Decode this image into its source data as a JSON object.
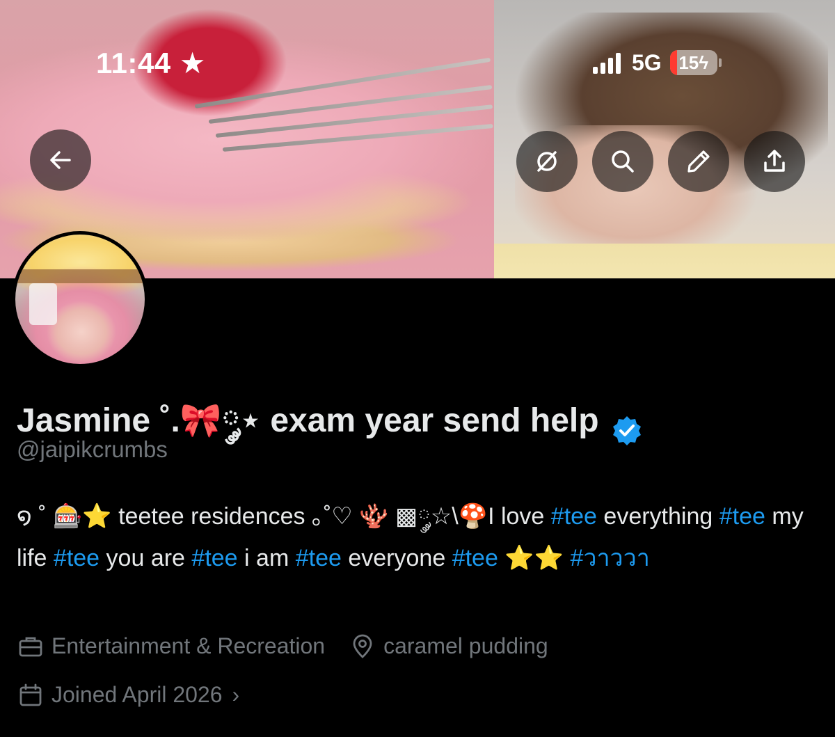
{
  "status_bar": {
    "time": "11:44",
    "time_badge": "★",
    "network": "5G",
    "battery": "15",
    "battery_level": 0.15,
    "battery_charge_glyph": "ϟ"
  },
  "banner": {
    "buttons": [
      "back-arrow-icon",
      "grok-icon",
      "search-icon",
      "edit-pencil-icon",
      "share-icon"
    ]
  },
  "profile": {
    "display_name": "Jasmine ˚.🎀༘⋆ exam year send help",
    "handle": "@jaipikcrumbs",
    "bio": {
      "segments": [
        {
          "text": "໑ ˚ 🎰⭐ teetee residences ｡˚♡ 🪸 ▩༘☆\\🍄I love ",
          "tag": false
        },
        {
          "text": "#tee",
          "tag": true
        },
        {
          "text": " everything ",
          "tag": false
        },
        {
          "text": "#tee",
          "tag": true
        },
        {
          "text": " my life ",
          "tag": false
        },
        {
          "text": "#tee",
          "tag": true
        },
        {
          "text": " you are ",
          "tag": false
        },
        {
          "text": "#tee",
          "tag": true
        },
        {
          "text": " i am ",
          "tag": false
        },
        {
          "text": "#tee",
          "tag": true
        },
        {
          "text": " everyone ",
          "tag": false
        },
        {
          "text": "#tee",
          "tag": true
        },
        {
          "text": " ⭐⭐ ",
          "tag": false
        },
        {
          "text": "#วาววา",
          "tag": true
        }
      ]
    },
    "category": "Entertainment & Recreation",
    "location": "caramel pudding",
    "joined": "Joined April 2026",
    "joined_chevron": "›"
  },
  "colors": {
    "background": "#000000",
    "text": "#e7e9ea",
    "muted": "#71767b",
    "link": "#1d9bf0",
    "verified": "#1d9bf0",
    "battery_low": "#ff3b30"
  }
}
